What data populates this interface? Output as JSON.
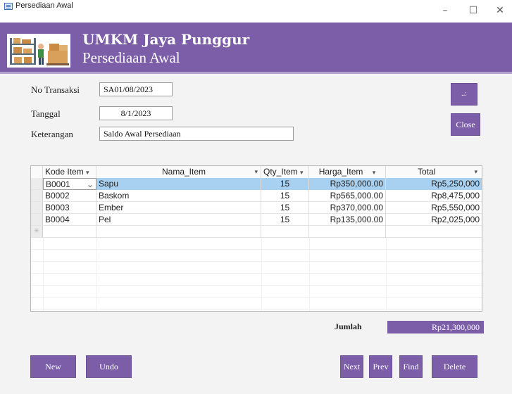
{
  "window": {
    "title": "Persediaan Awal",
    "controls": [
      "–",
      "☐",
      "✕"
    ]
  },
  "header": {
    "company": "UMKM Jaya Punggur",
    "form_title": "Persediaan Awal"
  },
  "form": {
    "no_transaksi_label": "No Transaksi",
    "no_transaksi_value": "SA01/08/2023",
    "tanggal_label": "Tanggal",
    "tanggal_value": "8/1/2023",
    "keterangan_label": "Keterangan",
    "keterangan_value": "Saldo Awal Persediaan"
  },
  "side_buttons": {
    "small_label": "..:",
    "close_label": "Close"
  },
  "grid": {
    "columns": [
      {
        "label": "Kode Item",
        "arrow": "▾"
      },
      {
        "label": "Nama_Item",
        "arrow": "▾"
      },
      {
        "label": "Qty_Item",
        "arrow": "▾"
      },
      {
        "label": "Harga_Item",
        "arrow": "▾"
      },
      {
        "label": "Total",
        "arrow": "▾"
      }
    ],
    "rows": [
      {
        "kode": "B0001",
        "nama": "Sapu",
        "qty": "15",
        "harga": "Rp350,000.00",
        "total": "Rp5,250,000"
      },
      {
        "kode": "B0002",
        "nama": "Baskom",
        "qty": "15",
        "harga": "Rp565,000.00",
        "total": "Rp8,475,000"
      },
      {
        "kode": "B0003",
        "nama": "Ember",
        "qty": "15",
        "harga": "Rp370,000.00",
        "total": "Rp5,550,000"
      },
      {
        "kode": "B0004",
        "nama": "Pel",
        "qty": "15",
        "harga": "Rp135,000.00",
        "total": "Rp2,025,000"
      }
    ],
    "new_row_marker": "✳",
    "dropdown_arrow": "⌄"
  },
  "summary": {
    "jumlah_label": "Jumlah",
    "jumlah_value": "Rp21,300,000"
  },
  "buttons": {
    "new": "New",
    "undo": "Undo",
    "next": "Next",
    "prev": "Prev",
    "find": "Find",
    "delete": "Delete"
  },
  "colors": {
    "accent": "#7b5ea7",
    "selected_row": "#a8d0f0"
  }
}
